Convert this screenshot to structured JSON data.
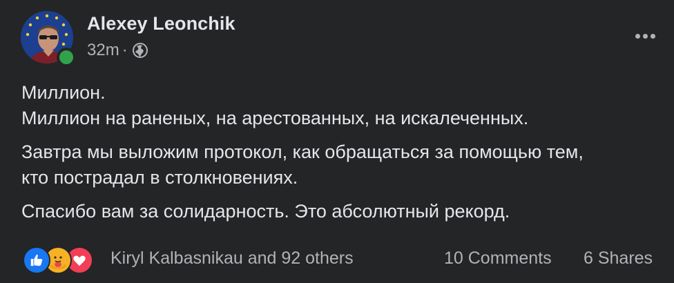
{
  "author": {
    "name": "Alexey Leonchik",
    "status": "online",
    "avatar_icon": "profile-photo"
  },
  "meta": {
    "time": "32m",
    "separator": "·",
    "privacy_icon": "globe-icon"
  },
  "post": {
    "paragraphs": [
      {
        "lines": [
          "Миллион.",
          "Миллион на раненых, на арестованных, на искалеченных."
        ]
      },
      {
        "lines": [
          "Завтра мы выложим протокол, как обращаться за помощью тем,",
          "кто пострадал в столкновениях."
        ]
      },
      {
        "lines": [
          "Спасибо вам за солидарность. Это абсолютный рекорд."
        ]
      }
    ]
  },
  "reactions": {
    "types": [
      "like",
      "care",
      "love"
    ],
    "summary": "Kiryl Kalbasnikau and 92 others",
    "comments": "10 Comments",
    "shares": "6 Shares"
  },
  "colors": {
    "background": "#242526",
    "text_primary": "#e4e6eb",
    "text_secondary": "#b0b3b8",
    "like_blue": "#1877f2",
    "care_yellow": "#f7b125",
    "love_red": "#f33e58",
    "online_green": "#31a24c"
  }
}
